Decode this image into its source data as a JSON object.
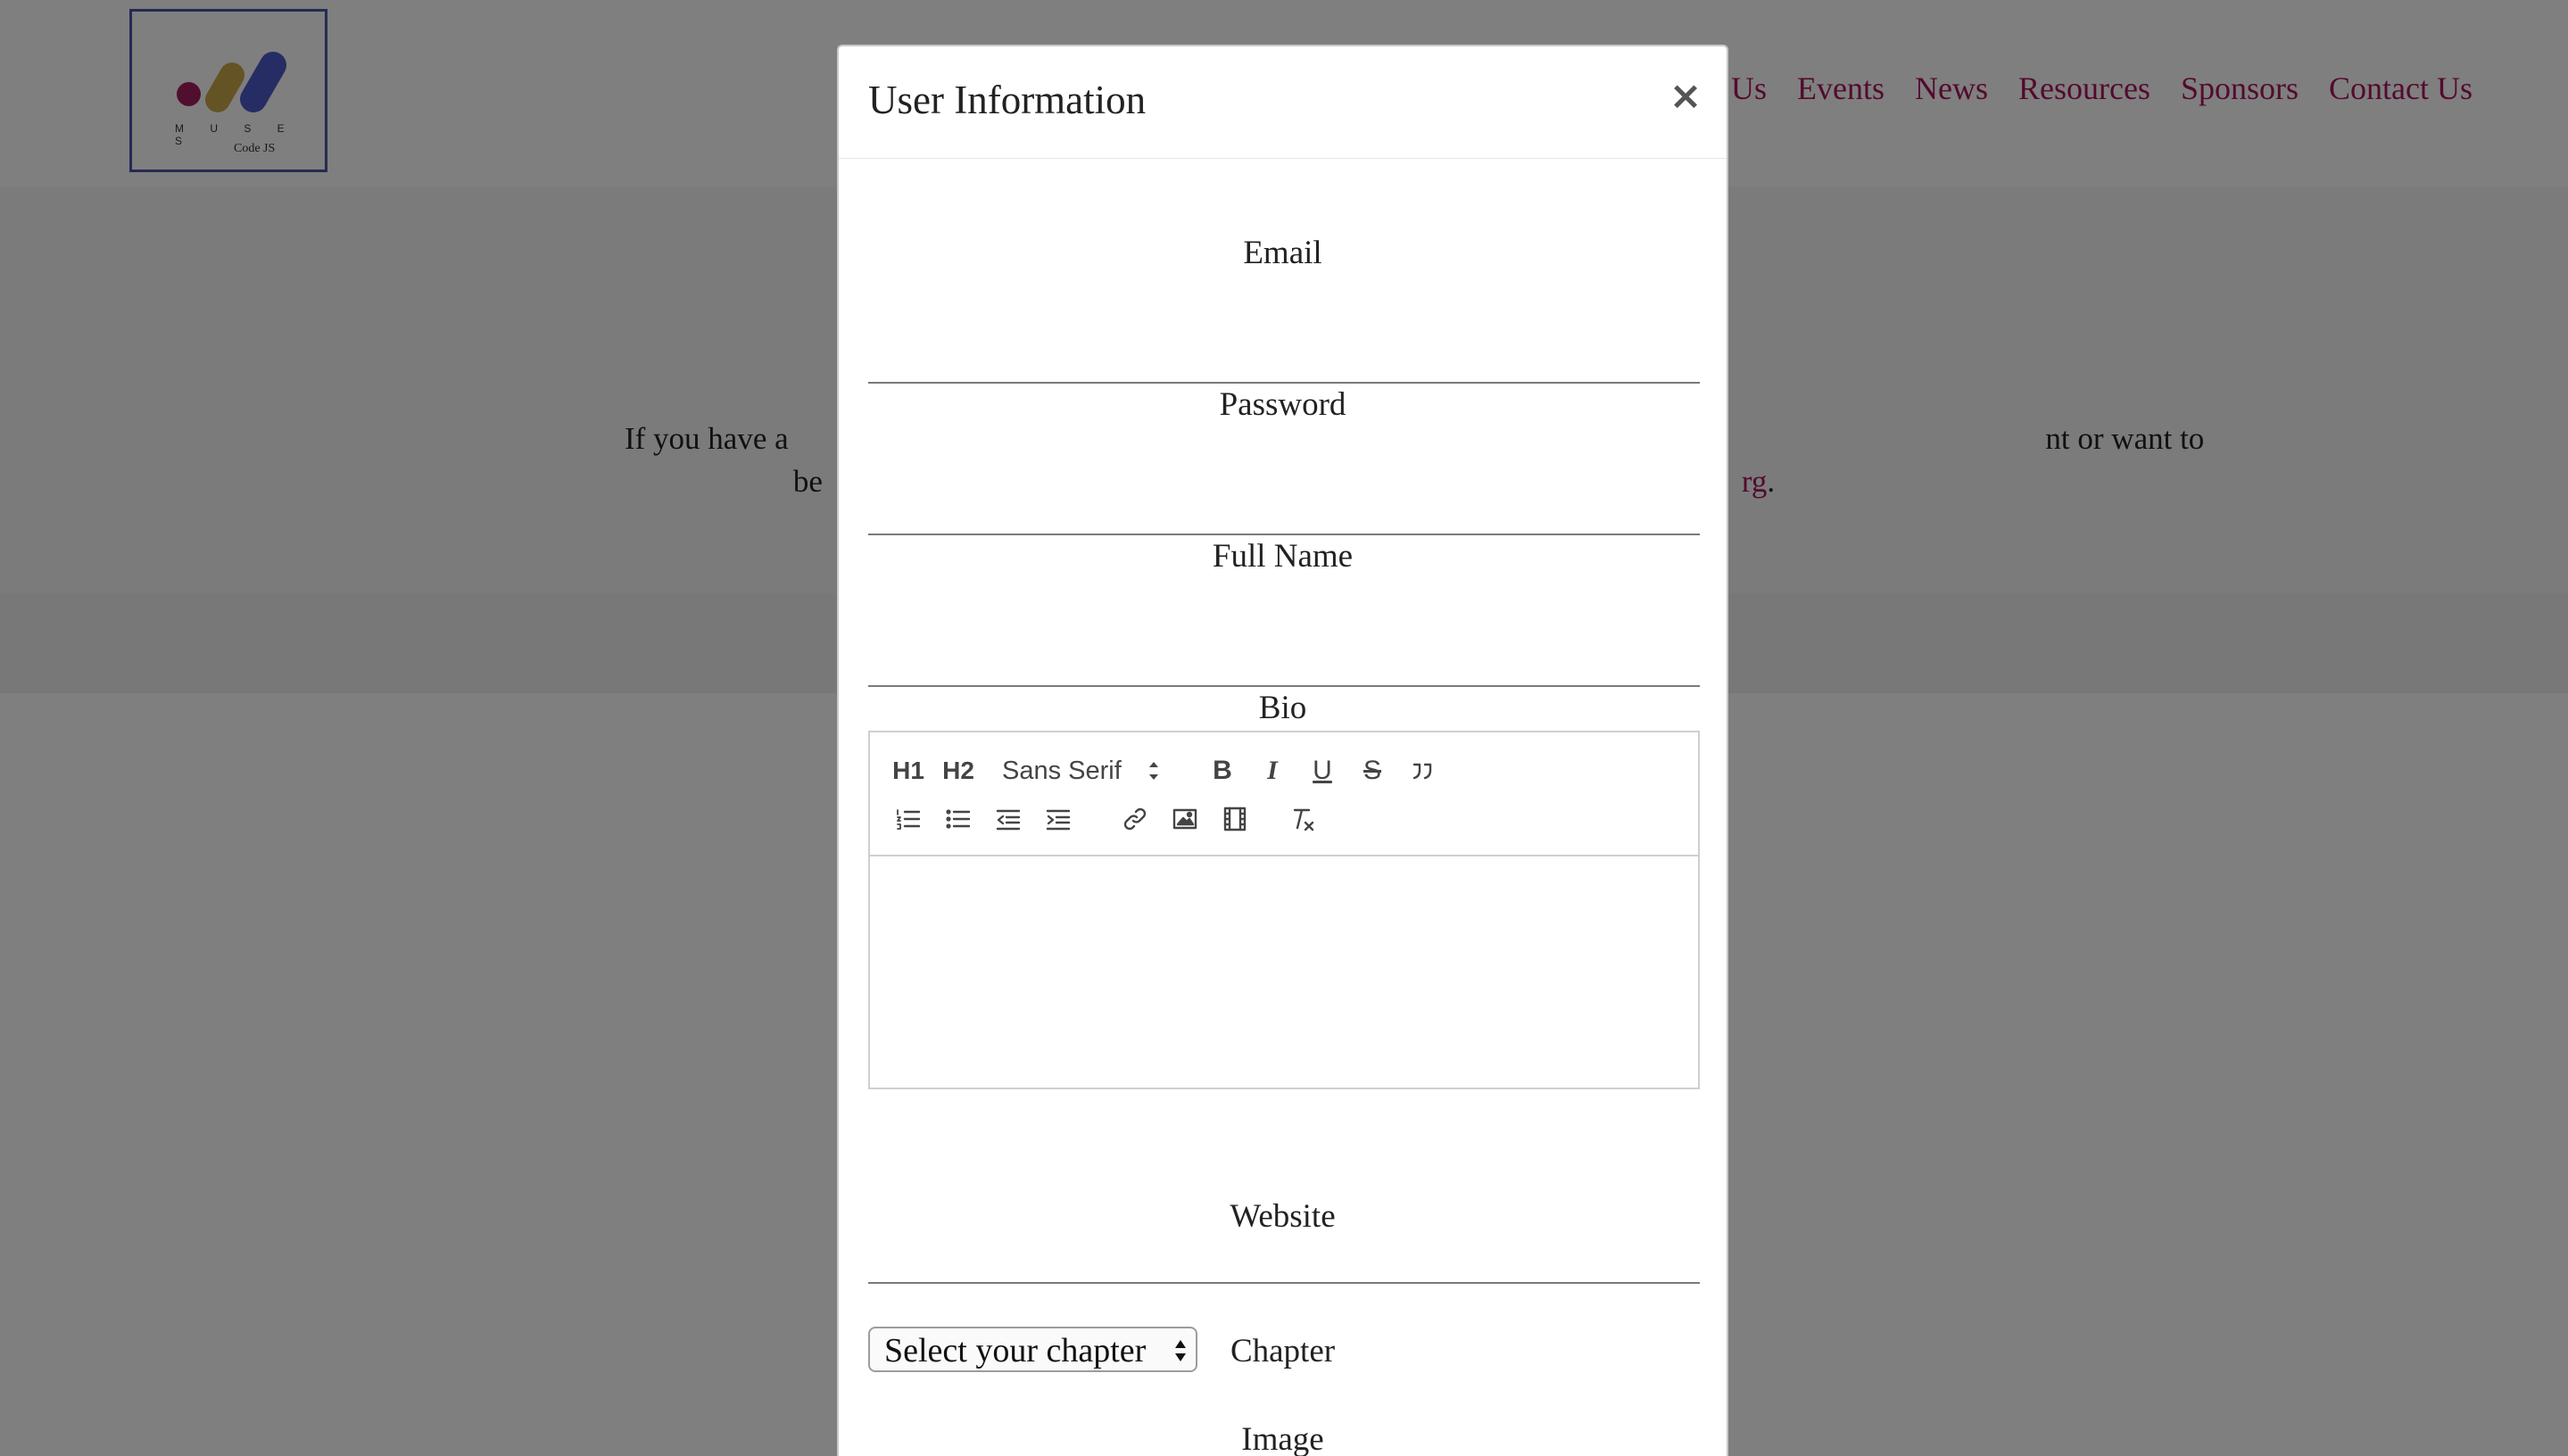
{
  "site": {
    "logo": {
      "brand": "M U S E S",
      "sub": "Code JS"
    },
    "nav": [
      "Us",
      "Events",
      "News",
      "Resources",
      "Sponsors",
      "Contact Us"
    ],
    "contact": {
      "line1": "If you have a                                                                                                                                                                 nt or want to",
      "line2_start": "be",
      "line2_link": "rg",
      "line2_end": "."
    }
  },
  "modal": {
    "title": "User Information",
    "close_glyph": "×",
    "fields": {
      "email_label": "Email",
      "email_value": "",
      "password_label": "Password",
      "password_value": "",
      "full_name_label": "Full Name",
      "full_name_value": "",
      "bio_label": "Bio",
      "website_label": "Website",
      "website_value": "",
      "chapter_label": "Chapter",
      "chapter_selected": "Select your chapter",
      "image_label": "Image"
    },
    "editor": {
      "h1": "H1",
      "h2": "H2",
      "font": "Sans Serif",
      "bold": "B",
      "italic": "I",
      "underline": "U",
      "strike": "S",
      "content": ""
    }
  },
  "colors": {
    "accent": "#a8145f",
    "logo_border": "#4a55a6",
    "overlay": "rgba(0,0,0,0.5)"
  },
  "icons": {
    "toolbar_row1": [
      "heading-1-icon",
      "heading-2-icon",
      "font-select",
      "bold-icon",
      "italic-icon",
      "underline-icon",
      "strikethrough-icon",
      "blockquote-icon"
    ],
    "toolbar_row2": [
      "ordered-list-icon",
      "bullet-list-icon",
      "outdent-icon",
      "indent-icon",
      "link-icon",
      "image-icon",
      "video-icon",
      "clear-format-icon"
    ]
  }
}
